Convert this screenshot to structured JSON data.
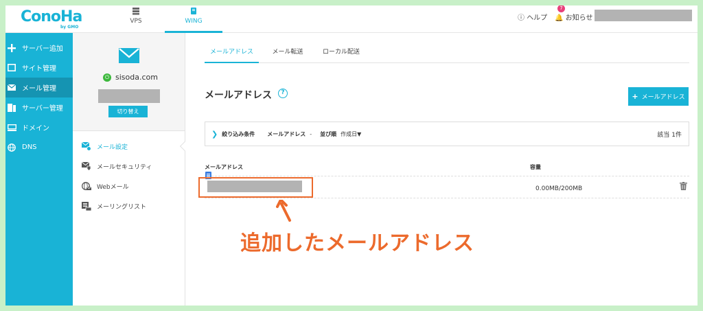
{
  "header": {
    "logo_text": "ConoHa",
    "logo_sub": "by GMO",
    "tabs": [
      {
        "label": "VPS"
      },
      {
        "label": "WING"
      }
    ],
    "help_label": "ヘルプ",
    "notice_label": "お知らせ",
    "notice_badge": "7"
  },
  "sidebar": {
    "items": [
      {
        "label": "サーバー追加",
        "icon": "plus-icon"
      },
      {
        "label": "サイト管理",
        "icon": "window-icon"
      },
      {
        "label": "メール管理",
        "icon": "mail-icon"
      },
      {
        "label": "サーバー管理",
        "icon": "server-icon"
      },
      {
        "label": "ドメイン",
        "icon": "domain-icon"
      },
      {
        "label": "DNS",
        "icon": "globe-icon"
      }
    ]
  },
  "panel2": {
    "domain": "sisoda.com",
    "switch_label": "切り替え",
    "menu": [
      {
        "label": "メール設定",
        "icon": "mail-settings-icon"
      },
      {
        "label": "メールセキュリティ",
        "icon": "mail-security-icon"
      },
      {
        "label": "Webメール",
        "icon": "webmail-icon"
      },
      {
        "label": "メーリングリスト",
        "icon": "mailing-list-icon"
      }
    ]
  },
  "main": {
    "tabs": [
      {
        "label": "メールアドレス"
      },
      {
        "label": "メール転送"
      },
      {
        "label": "ローカル配送"
      }
    ],
    "title": "メールアドレス",
    "help_glyph": "?",
    "add_button": "メールアドレス",
    "filter": {
      "label": "絞り込み条件",
      "field": "メールアドレス",
      "dash": "-",
      "sort_label": "並び順",
      "sort_value": "作成日▼",
      "count": "該当 1件"
    },
    "table": {
      "col_address": "メールアドレス",
      "col_capacity": "容量",
      "rows": [
        {
          "capacity": "0.00MB/200MB"
        }
      ]
    }
  },
  "annotation": {
    "text": "追加したメールアドレス",
    "color": "#ec6a2c"
  },
  "colors": {
    "accent": "#19b3d6",
    "sidebar_active": "#1594b2",
    "highlight": "#ec6a2c"
  }
}
